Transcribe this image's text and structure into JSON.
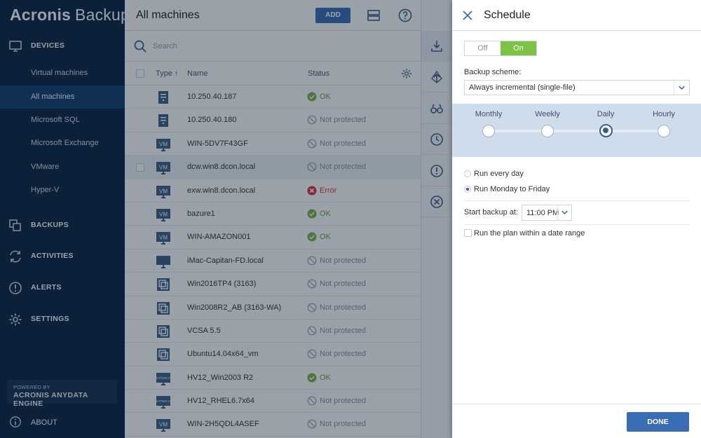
{
  "sidebar": {
    "logo_brand": "Acronis",
    "logo_product": "Backup",
    "sections": {
      "devices": "DEVICES",
      "backups": "BACKUPS",
      "activities": "ACTIVITIES",
      "alerts": "ALERTS",
      "settings": "SETTINGS"
    },
    "device_items": [
      "Virtual machines",
      "All machines",
      "Microsoft SQL",
      "Microsoft Exchange",
      "VMware",
      "Hyper-V"
    ],
    "powered_by": "POWERED BY",
    "engine": "ACRONIS ANYDATA ENGINE",
    "about": "ABOUT"
  },
  "main": {
    "title": "All machines",
    "add_label": "ADD",
    "search_placeholder": "Search",
    "columns": {
      "type": "Type ↑",
      "name": "Name",
      "status": "Status"
    },
    "rows": [
      {
        "name": "10.250.40.187",
        "status": "OK",
        "type_icon": "server-icon",
        "status_kind": "ok"
      },
      {
        "name": "10.250.40.180",
        "status": "Not protected",
        "type_icon": "server-icon",
        "status_kind": "none"
      },
      {
        "name": "WIN-5DV7F43GF",
        "status": "Not protected",
        "type_icon": "vm-icon",
        "status_kind": "none"
      },
      {
        "name": "dcw.win8.dcon.local",
        "status": "Not protected",
        "type_icon": "vm-icon",
        "status_kind": "none"
      },
      {
        "name": "exw.win8.dcon.local",
        "status": "Error",
        "type_icon": "vm-icon",
        "status_kind": "error"
      },
      {
        "name": "bazure1",
        "status": "OK",
        "type_icon": "vm-icon",
        "status_kind": "ok"
      },
      {
        "name": "WIN-AMAZON001",
        "status": "OK",
        "type_icon": "vm-icon",
        "status_kind": "ok"
      },
      {
        "name": "iMac-Capitan-FD.local",
        "status": "Not protected",
        "type_icon": "workstation-icon",
        "status_kind": "none"
      },
      {
        "name": "Win2016TP4 (3163)",
        "status": "Not protected",
        "type_icon": "virtual-host-icon",
        "status_kind": "none"
      },
      {
        "name": "Win2008R2_AB (3163-WA)",
        "status": "Not protected",
        "type_icon": "virtual-host-icon",
        "status_kind": "none"
      },
      {
        "name": "VCSA 5.5",
        "status": "Not protected",
        "type_icon": "virtual-host-icon",
        "status_kind": "none"
      },
      {
        "name": "Ubuntu14.04x64_vm",
        "status": "Not protected",
        "type_icon": "virtual-host-icon",
        "status_kind": "none"
      },
      {
        "name": "HV12_Win2003 R2",
        "status": "OK",
        "type_icon": "hyperv-icon",
        "status_kind": "ok"
      },
      {
        "name": "HV12_RHEL6.7x64",
        "status": "Not protected",
        "type_icon": "hyperv-icon",
        "status_kind": "none"
      },
      {
        "name": "WIN-2H5QDL4ASEF",
        "status": "Not protected",
        "type_icon": "vm-icon",
        "status_kind": "none"
      }
    ],
    "vm_badge": "VM",
    "hyperv_badge": "HYPER-V"
  },
  "panel": {
    "title": "Schedule",
    "toggle_off": "Off",
    "toggle_on": "On",
    "scheme_label": "Backup scheme:",
    "scheme_value": "Always incremental (single-file)",
    "frequencies": [
      "Monthly",
      "Weekly",
      "Daily",
      "Hourly"
    ],
    "selected_frequency": "Daily",
    "run_every_day": "Run every day",
    "run_mon_fri": "Run Monday to Friday",
    "start_label": "Start backup at:",
    "start_time": "11:00 PM",
    "date_range": "Run the plan within a date range",
    "done": "DONE"
  },
  "colors": {
    "sidebar_bg": "#0b2240",
    "accent_blue": "#3b6db4",
    "toggle_on_green": "#7cc243",
    "ok_green": "#7cb342",
    "error_red": "#d9342b"
  }
}
